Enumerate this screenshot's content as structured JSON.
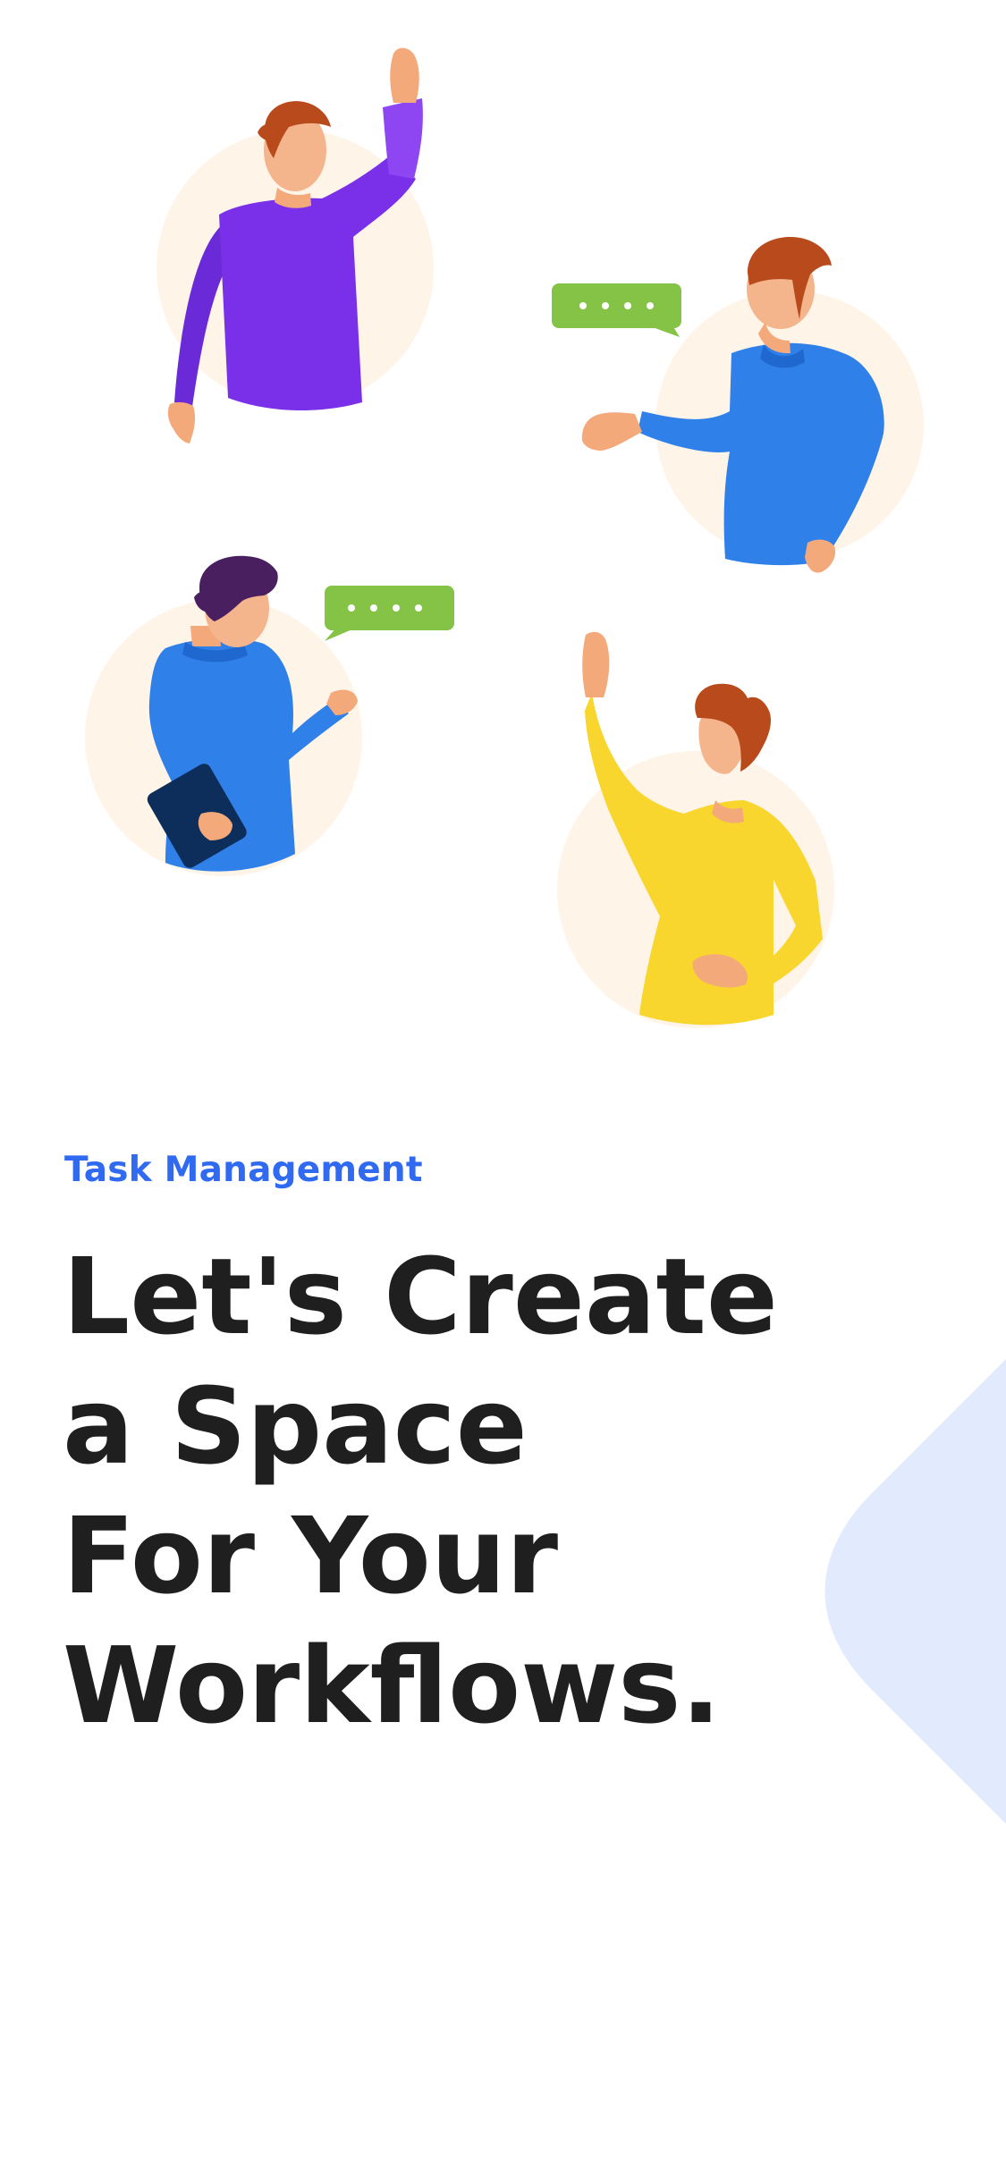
{
  "colors": {
    "background": "#ffffff",
    "accent_blue": "#2f6af0",
    "headline_text": "#1f1f1f",
    "soft_circle": "#fff4e8",
    "corner_shape": "#e2ebfd",
    "chat_bubble": "#84c346",
    "purple_shirt": "#7a30e8",
    "blue_shirt": "#2f80e8",
    "yellow_shirt": "#f8d62d",
    "skin": "#f4a97b",
    "hair_brown": "#b84a1b",
    "hair_dark": "#4a1f5f"
  },
  "illustration": {
    "characters": [
      {
        "name": "waving-person",
        "shirt": "purple"
      },
      {
        "name": "talking-person",
        "shirt": "blue"
      },
      {
        "name": "tablet-person",
        "shirt": "blue"
      },
      {
        "name": "raising-hand-person",
        "shirt": "yellow"
      }
    ],
    "icons": [
      "chat-bubble-icon",
      "chat-bubble-icon"
    ]
  },
  "content": {
    "eyebrow": "Task Management",
    "headline": {
      "line_1": "Let's Create",
      "line_2": "a Space",
      "line_3": "For Your",
      "line_4": "Workflows."
    }
  }
}
